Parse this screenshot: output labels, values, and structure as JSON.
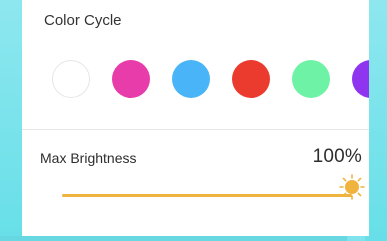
{
  "sections": {
    "color_cycle": {
      "title": "Color Cycle",
      "swatches": [
        {
          "name": "color-swatch-white",
          "color": "#ffffff"
        },
        {
          "name": "color-swatch-pink",
          "color": "#e83cab"
        },
        {
          "name": "color-swatch-blue",
          "color": "#49b4f7"
        },
        {
          "name": "color-swatch-red",
          "color": "#eb3b2f"
        },
        {
          "name": "color-swatch-green",
          "color": "#6ef3a6"
        },
        {
          "name": "color-swatch-purple",
          "color": "#8f35ef"
        }
      ]
    },
    "brightness": {
      "label": "Max Brightness",
      "value": "100%",
      "level": 1.0
    }
  },
  "colors": {
    "accent": "#f0b33d",
    "background": "#7ee3ec",
    "panel": "#ffffff",
    "divider": "#e7e7ea",
    "text": "#2d2d2d"
  }
}
